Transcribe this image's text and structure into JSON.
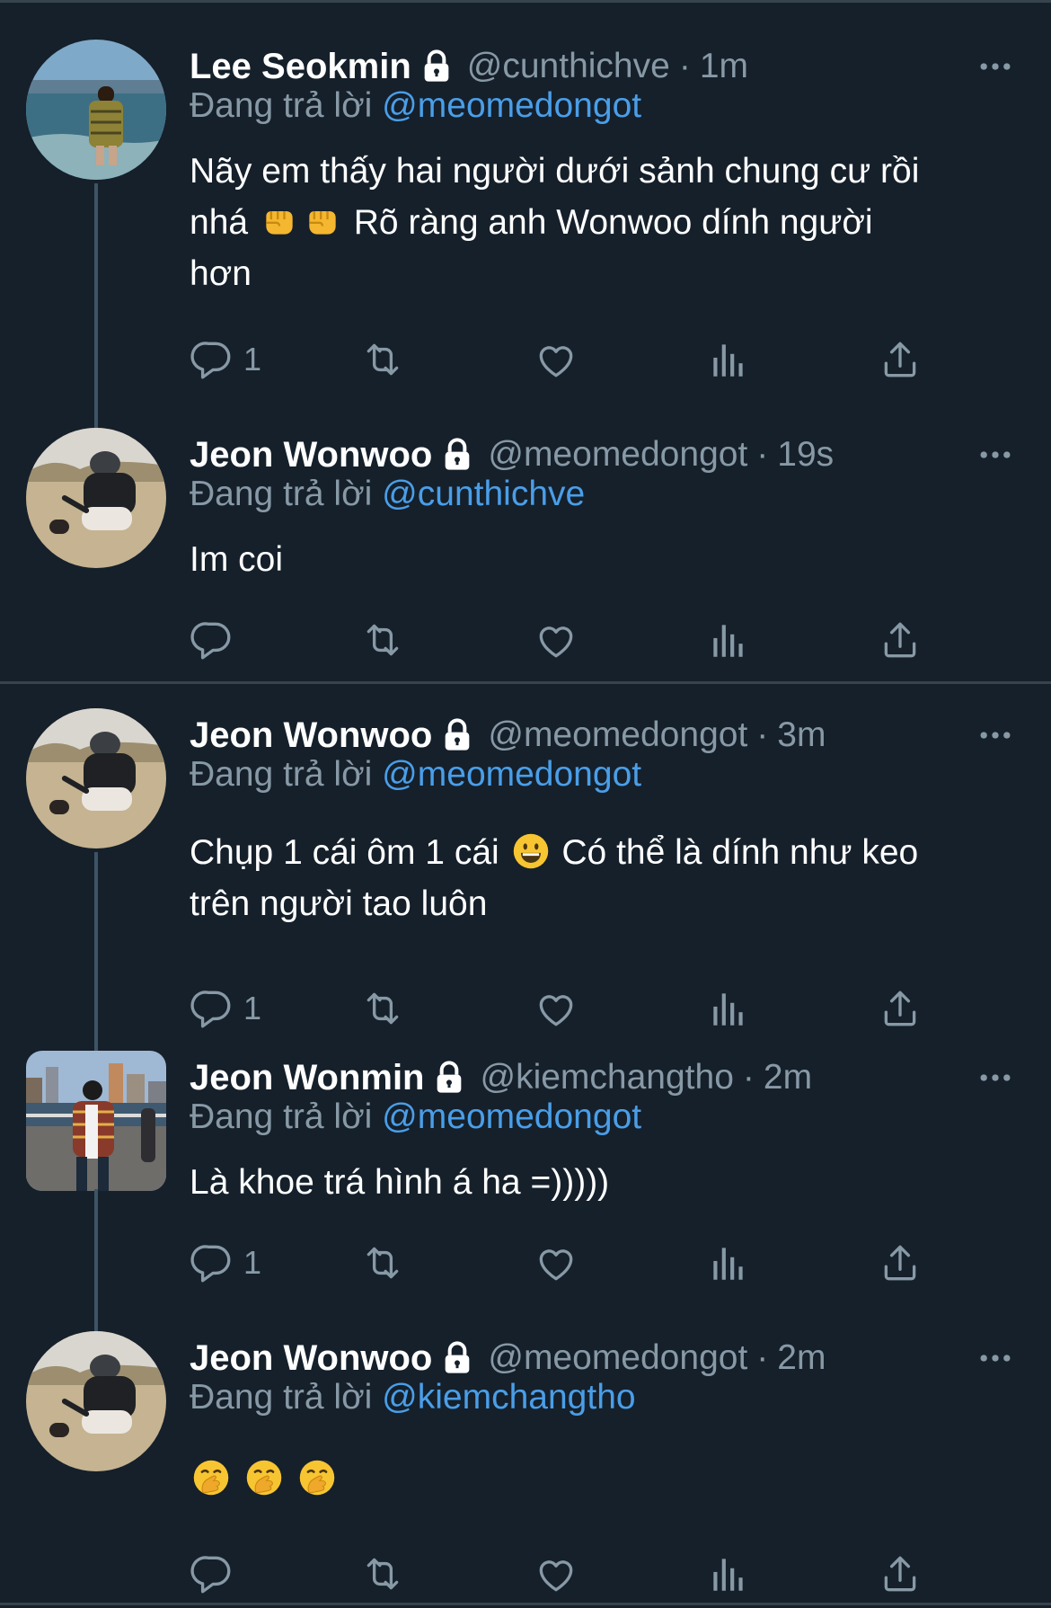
{
  "tweets": [
    {
      "name": "Lee Seokmin",
      "handle": "@cunthichve",
      "sep": "·",
      "time": "1m",
      "replying_prefix": "Đang trả lời ",
      "replying_to": "@meomedongot",
      "text_line1": "Nãy em thấy hai người dưới sảnh chung cư rồi",
      "text_line2_a": "nhá",
      "text_line2_b": "Rõ ràng anh Wonwoo dính người",
      "text_line3": "hơn",
      "reply_count": "1"
    },
    {
      "name": "Jeon Wonwoo",
      "handle": "@meomedongot",
      "sep": "·",
      "time": "19s",
      "replying_prefix": "Đang trả lời ",
      "replying_to": "@cunthichve",
      "text_line1": "Im coi",
      "reply_count": ""
    },
    {
      "name": "Jeon Wonwoo",
      "handle": "@meomedongot",
      "sep": "·",
      "time": "3m",
      "replying_prefix": "Đang trả lời ",
      "replying_to": "@meomedongot",
      "text_line1_a": "Chụp 1 cái ôm 1 cái",
      "text_line1_b": "Có thể là dính như keo",
      "text_line2": "trên người tao luôn",
      "reply_count": "1"
    },
    {
      "name": "Jeon Wonmin",
      "handle": "@kiemchangtho",
      "sep": "·",
      "time": "2m",
      "replying_prefix": "Đang trả lời ",
      "replying_to": "@meomedongot",
      "text_line1": "Là khoe trá hình á ha =)))))",
      "reply_count": "1"
    },
    {
      "name": "Jeon Wonwoo",
      "handle": "@meomedongot",
      "sep": "·",
      "time": "2m",
      "replying_prefix": "Đang trả lời ",
      "replying_to": "@kiemchangtho",
      "reply_count": ""
    }
  ],
  "icons": {
    "lock": "lock-icon",
    "more": "more-icon",
    "reply": "reply-icon",
    "retweet": "retweet-icon",
    "like": "like-icon",
    "views": "views-icon",
    "share": "share-icon",
    "emoji_fist": "oncoming-fist-emoji",
    "emoji_smile": "grinning-face-emoji",
    "emoji_hand_mouth": "face-with-hand-over-mouth-emoji"
  },
  "colors": {
    "background": "#15202b",
    "secondary_text": "#8899a6",
    "mention": "#4a9ee8",
    "divider": "#38444d"
  }
}
